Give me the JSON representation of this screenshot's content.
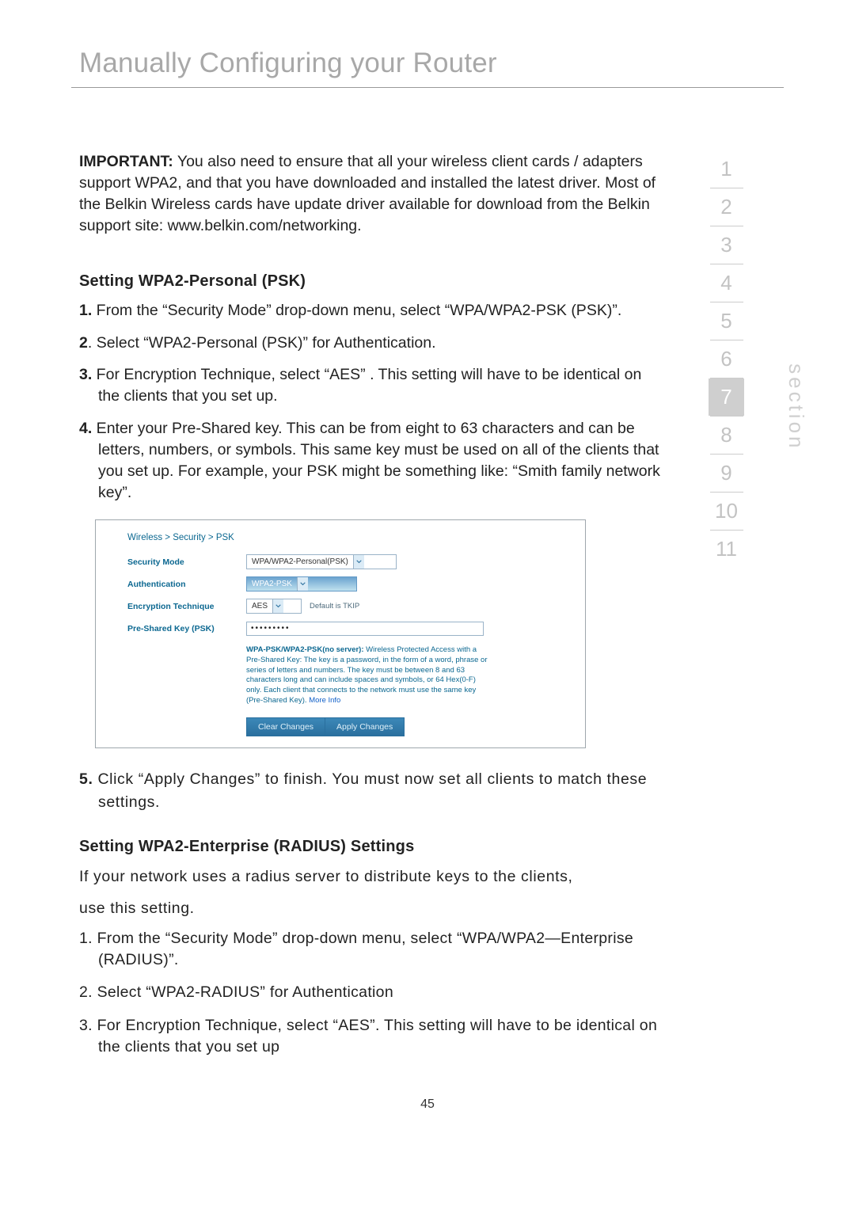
{
  "page": {
    "title": "Manually Configuring your Router",
    "page_number": "45"
  },
  "important": {
    "label": "IMPORTANT:",
    "text": " You also need to ensure that all your wireless client cards / adapters support WPA2, and that you have downloaded and installed the latest driver. Most of the Belkin Wireless cards have update driver available for download from the Belkin support site: www.belkin.com/networking."
  },
  "psk": {
    "heading": "Setting WPA2-Personal (PSK)",
    "steps": {
      "n1": "1.",
      "t1": " From the “Security Mode” drop-down menu, select “WPA/WPA2-PSK (PSK)”.",
      "n2": "2",
      "t2": ". Select “WPA2-Personal (PSK)” for Authentication.",
      "n3": "3.",
      "t3": " For Encryption Technique, select “AES” . This setting will have to be identical on the clients that you set up.",
      "n4": "4.",
      "t4": " Enter your Pre-Shared key. This can be from eight to 63 characters and can be letters, numbers, or symbols. This same key must be used on all of the clients that you set up. For example, your PSK might be something like: “Smith family network key”.",
      "n5": "5.",
      "t5": " Click “Apply Changes” to finish. You must now set all clients to match these settings."
    }
  },
  "router": {
    "breadcrumb": "Wireless > Security > PSK",
    "labels": {
      "secmode": "Security Mode",
      "auth": "Authentication",
      "enc": "Encryption Technique",
      "psk": "Pre-Shared Key (PSK)"
    },
    "values": {
      "secmode": "WPA/WPA2-Personal(PSK)",
      "auth": "WPA2-PSK",
      "enc": "AES",
      "enc_hint": "Default is TKIP",
      "psk_mask": "•••••••••"
    },
    "help_bold": "WPA-PSK/WPA2-PSK(no server):",
    "help_text": " Wireless Protected Access with a Pre-Shared Key: The key is a password, in the form of a word, phrase or series of letters and numbers. The key must be between 8 and 63 characters long and can include spaces and symbols, or 64 Hex(0-F) only. Each client that connects to the network must use the same key (Pre-Shared Key). ",
    "help_link": "More Info",
    "buttons": {
      "clear": "Clear Changes",
      "apply": "Apply Changes"
    }
  },
  "radius": {
    "heading": "Setting WPA2-Enterprise (RADIUS) Settings",
    "intro1": "If your network uses a radius server to distribute keys to the clients,",
    "intro2": "use this setting.",
    "s1": "1. From the “Security Mode” drop-down menu, select “WPA/WPA2—Enterprise (RADIUS)”.",
    "s2": "2. Select “WPA2-RADIUS” for Authentication",
    "s3": "3. For Encryption Technique, select “AES”. This setting will have to be identical on the clients that you set up"
  },
  "nav": {
    "items": [
      "1",
      "2",
      "3",
      "4",
      "5",
      "6",
      "7",
      "8",
      "9",
      "10",
      "11"
    ],
    "active_index": 6,
    "label": "section"
  }
}
